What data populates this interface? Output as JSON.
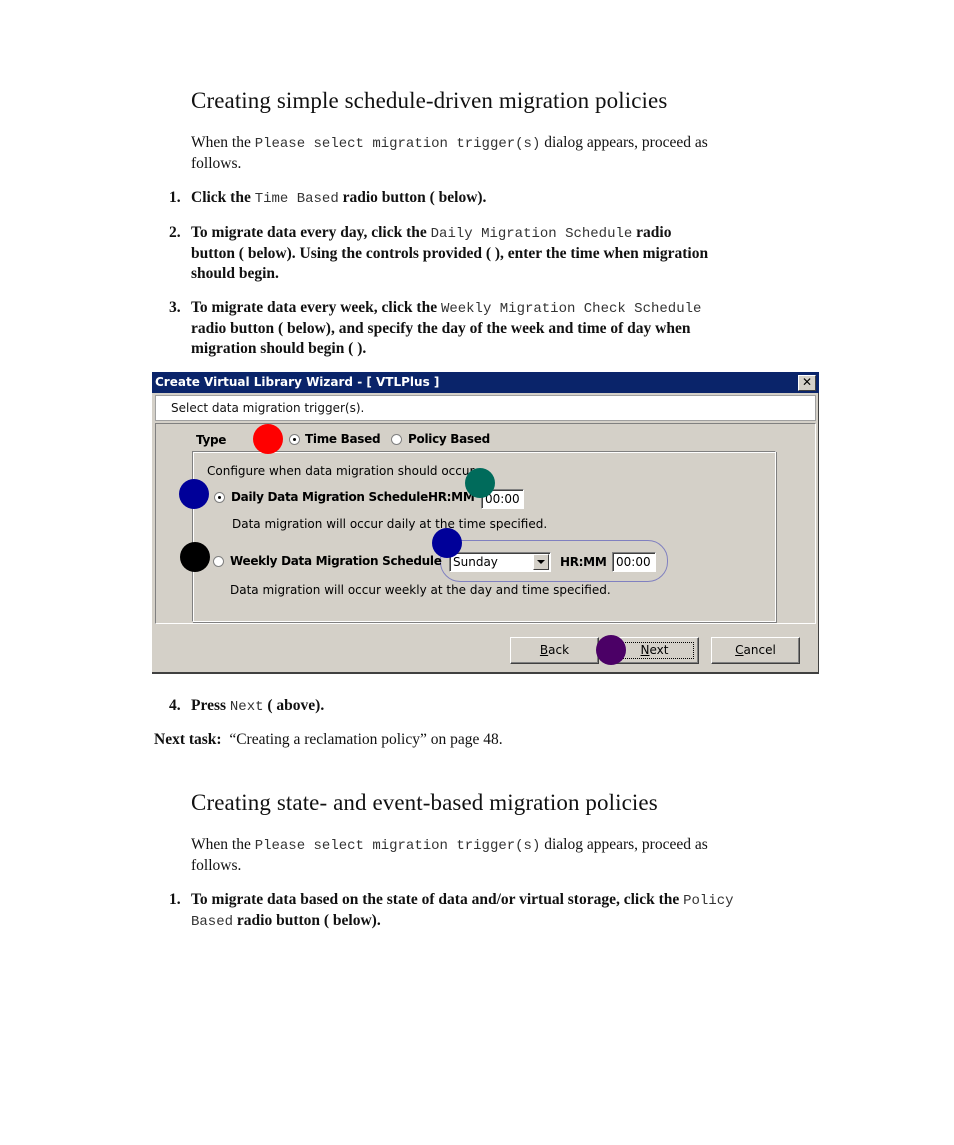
{
  "section1": {
    "heading": "Creating simple schedule-driven migration policies",
    "intro_pre": "When the ",
    "intro_code": "Please select migration trigger(s)",
    "intro_post": " dialog appears, proceed as",
    "intro_line2": "follows.",
    "steps": [
      {
        "num": "1.",
        "pre": "Click the ",
        "code": "Time Based",
        "post": " radio button (   below)."
      },
      {
        "num": "2.",
        "pre": "To migrate data every day, click the ",
        "code": "Daily Migration Schedule",
        "post": " radio",
        "line2": "button (   below). Using the controls provided (  ), enter the time when migration",
        "line3": "should begin."
      },
      {
        "num": "3.",
        "pre": "To migrate data every week, click the ",
        "code": "Weekly Migration Check Schedule",
        "line2": "radio button (   below), and specify the day of the week and time of day when",
        "line3": "migration should begin (  )."
      },
      {
        "num": "4.",
        "pre": "Press ",
        "code": "Next",
        "post": " (   above)."
      }
    ],
    "next_task_label": "Next task:",
    "next_task_text": "“Creating a reclamation policy” on page 48."
  },
  "dialog": {
    "title": "Create Virtual Library Wizard - [ VTLPlus ]",
    "close_glyph": "✕",
    "header": "Select data migration trigger(s).",
    "type_label": "Type",
    "type_options": [
      {
        "label": "Time Based",
        "selected": true
      },
      {
        "label": "Policy Based",
        "selected": false
      }
    ],
    "group_caption": "Configure when data migration should occur",
    "daily": {
      "label": "Daily Data Migration Schedule",
      "selected": true,
      "hrmm_label": "HR:MM",
      "time_value": "00:00",
      "description": "Data migration will occur daily at the time specified."
    },
    "weekly": {
      "label": "Weekly Data Migration Schedule",
      "selected": false,
      "day_value": "Sunday",
      "hrmm_label": "HR:MM",
      "time_value": "00:00",
      "description": "Data migration will occur weekly at the day and time specified."
    },
    "buttons": {
      "back": {
        "mnemonic": "B",
        "rest": "ack"
      },
      "next": {
        "mnemonic": "N",
        "rest": "ext"
      },
      "cancel": {
        "mnemonic": "C",
        "rest": "ancel"
      }
    },
    "callout_colors": {
      "time_based": "#ff0000",
      "daily": "#000099",
      "daily_time": "#006b5b",
      "weekly": "#000000",
      "weekly_controls": "#000099",
      "next": "#4b0066"
    }
  },
  "section2": {
    "heading": "Creating state- and event-based migration policies",
    "intro_pre": "When the ",
    "intro_code": "Please select migration trigger(s)",
    "intro_post": " dialog appears, proceed as",
    "intro_line2": "follows.",
    "step1": {
      "num": "1.",
      "pre": "To migrate data based on the state of data and/or virtual storage, click the ",
      "code1": "Policy",
      "code2": "Based",
      "post": " radio button (   below)."
    }
  }
}
